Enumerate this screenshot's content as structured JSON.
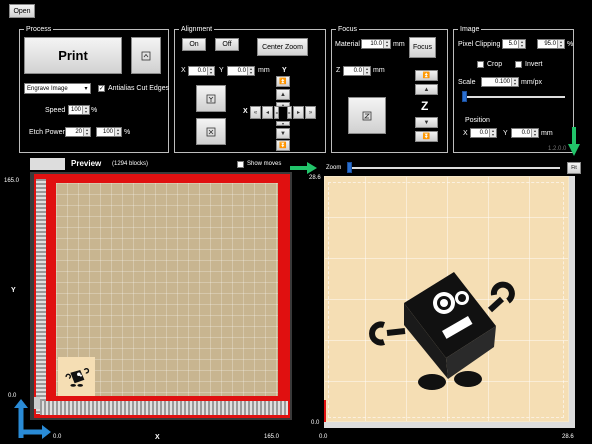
{
  "toolbar": {
    "open_label": "Open"
  },
  "process": {
    "title": "Process",
    "print_label": "Print",
    "mode_value": "Engrave Image",
    "antialias_label": "Antialias Cut Edges",
    "antialias_checked": "✓",
    "speed_label": "Speed",
    "speed_value": "100",
    "speed_unit": "%",
    "etch_label": "Etch Power",
    "etch_value1": "20",
    "etch_value2": "100",
    "etch_unit": "%"
  },
  "alignment": {
    "title": "Alignment",
    "on_label": "On",
    "off_label": "Off",
    "center_zoom_label": "Center Zoom",
    "x_label": "X",
    "x_value": "0.0",
    "y_label": "Y",
    "y_value": "0.0",
    "unit": "mm",
    "y_axis_label": "Y",
    "x_axis_label": "X"
  },
  "focus": {
    "title": "Focus",
    "material_label": "Material",
    "material_value": "10.0",
    "material_unit": "mm",
    "focus_label": "Focus",
    "z_label": "Z",
    "z_value": "0.0",
    "z_unit": "mm",
    "z_axis_label": "Z"
  },
  "image": {
    "title": "Image",
    "pixel_clipping_label": "Pixel Clipping",
    "clip_low": "5.0",
    "clip_high": "95.0",
    "clip_unit": "%",
    "crop_label": "Crop",
    "invert_label": "Invert",
    "scale_label": "Scale",
    "scale_value": "0.100",
    "scale_unit": "mm/px",
    "position_label": "Position",
    "pos_x_label": "X",
    "pos_x_value": "0.0",
    "pos_y_label": "Y",
    "pos_y_value": "0.0",
    "pos_unit": "mm",
    "version": "1.2.0.0"
  },
  "preview": {
    "title": "Preview",
    "blocks": "(1294 blocks)",
    "show_moves_label": "Show moves",
    "y_max": "165.0",
    "y_min": "0.0",
    "y_axis": "Y",
    "x_min": "0.0",
    "x_max": "165.0",
    "x_axis": "X"
  },
  "zoomview": {
    "zoom_label": "Zoom",
    "fit_label": "Fit",
    "y_max": "28.6",
    "y_min": "0.0",
    "x_min": "0.0",
    "x_max": "28.6"
  },
  "colors": {
    "bed_red": "#e01010",
    "arrow_green": "#22c46a",
    "arrow_blue": "#2a8bd6"
  }
}
